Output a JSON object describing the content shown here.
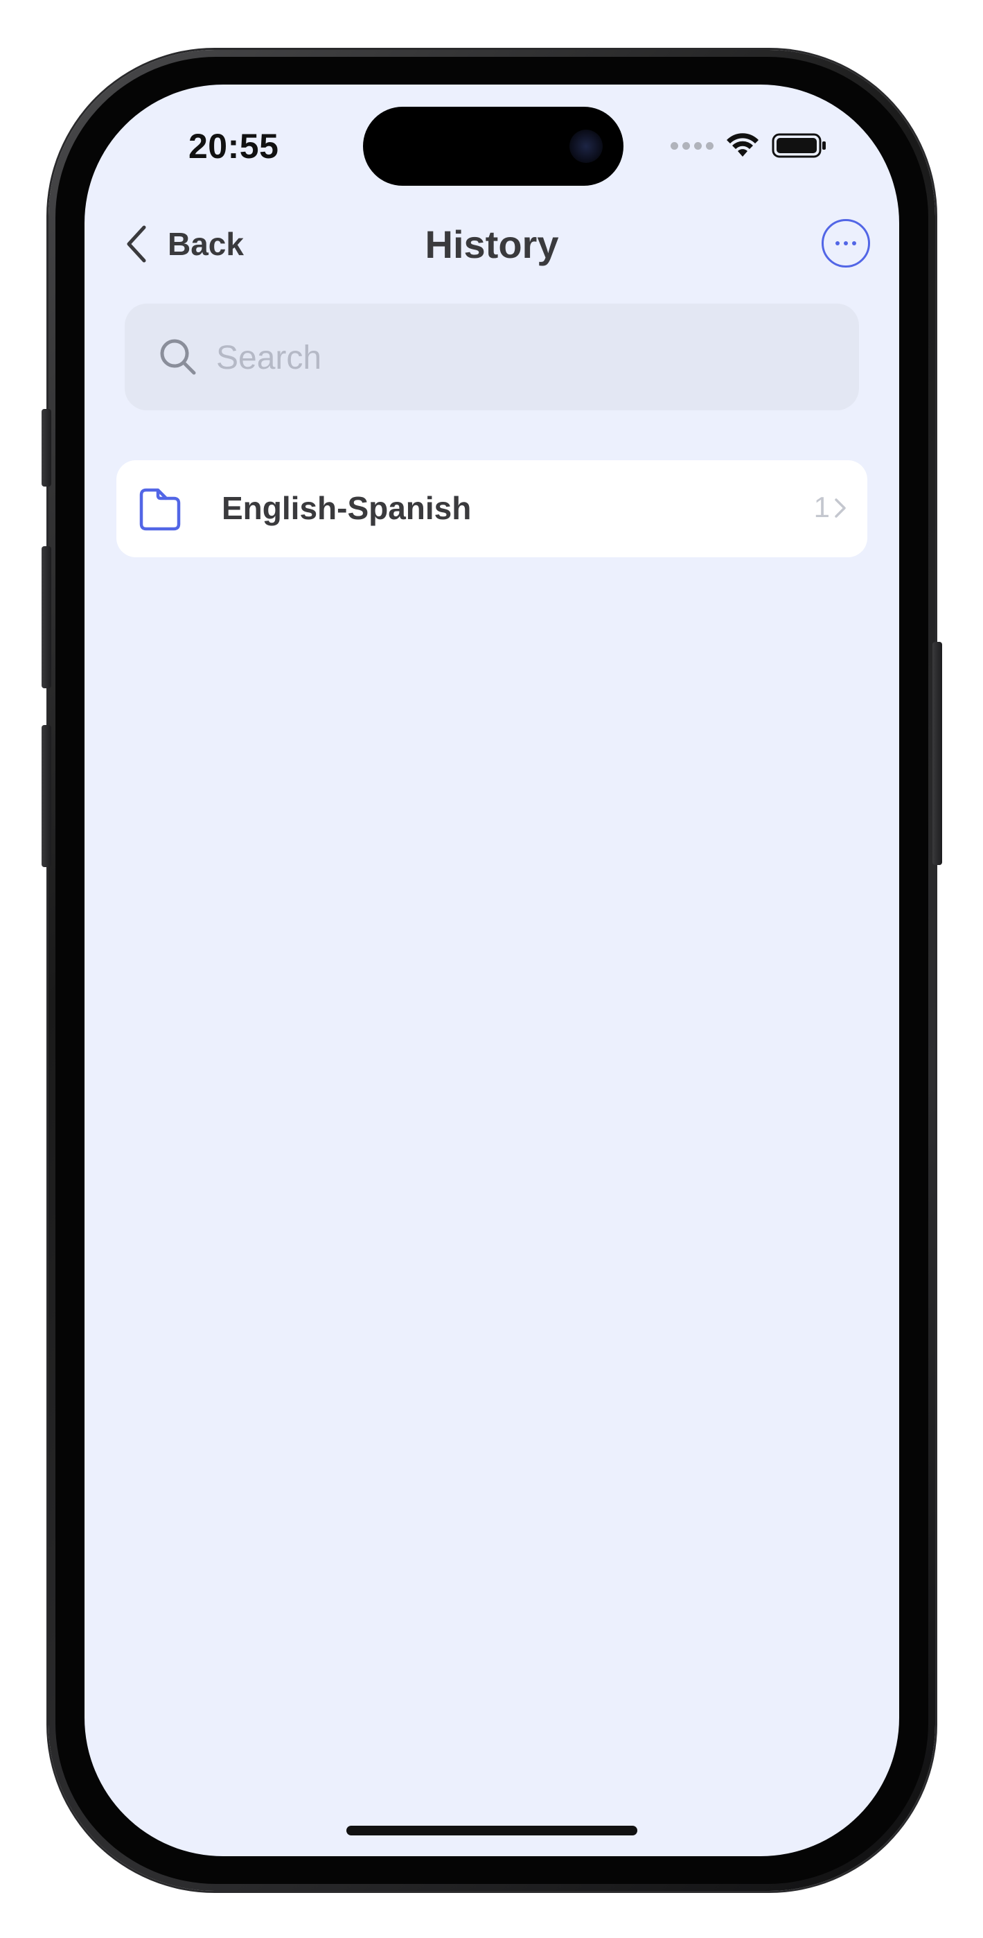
{
  "status_bar": {
    "time": "20:55"
  },
  "nav": {
    "back_label": "Back",
    "title": "History",
    "more_icon": "ellipsis-circle-icon"
  },
  "search": {
    "placeholder": "Search",
    "value": ""
  },
  "list": {
    "items": [
      {
        "label": "English-Spanish",
        "count": "1",
        "icon": "folder-icon"
      }
    ]
  },
  "colors": {
    "accent": "#5266e6",
    "background": "#ecf0fd",
    "search_field": "#e3e7f3",
    "card": "#ffffff",
    "title_text": "#3a3a3d"
  }
}
